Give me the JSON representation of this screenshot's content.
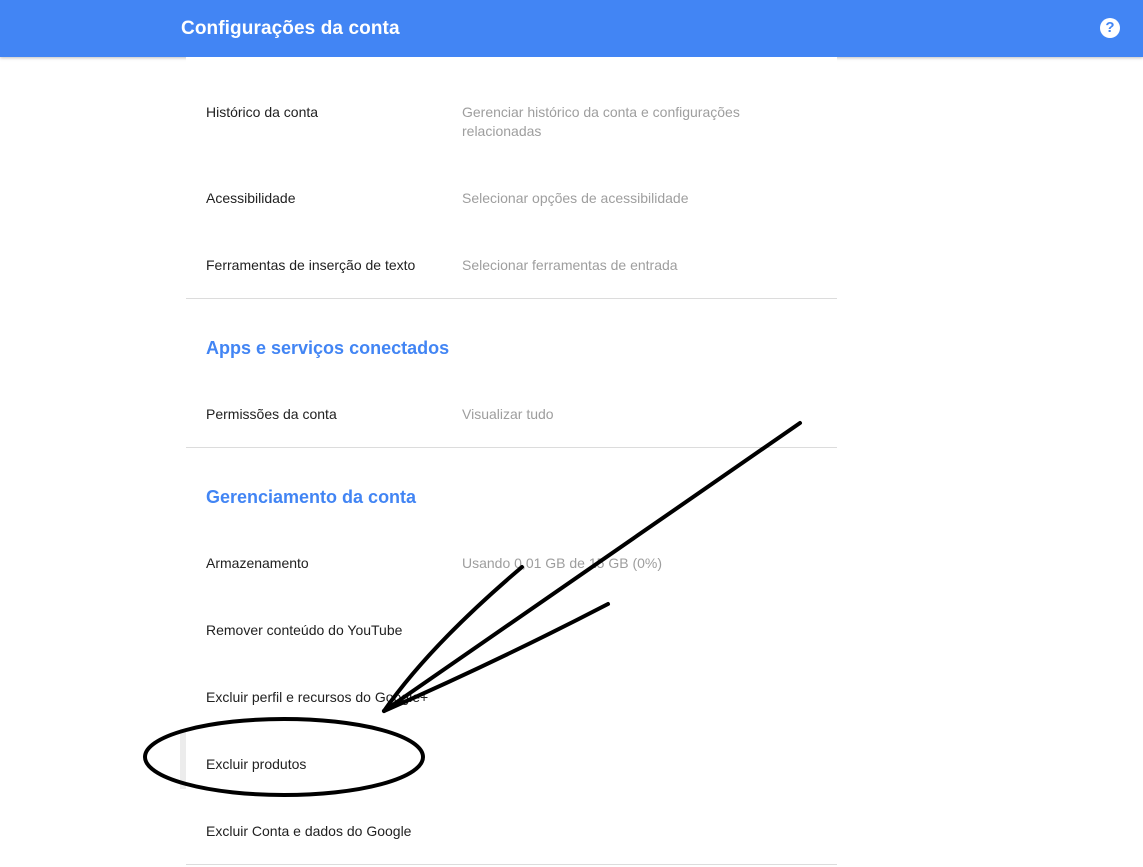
{
  "header": {
    "title": "Configurações da conta",
    "help_icon": "?"
  },
  "preferences": {
    "items": [
      {
        "label": "Histórico da conta",
        "desc": "Gerenciar histórico da conta e configurações relacionadas"
      },
      {
        "label": "Acessibilidade",
        "desc": "Selecionar opções de acessibilidade"
      },
      {
        "label": "Ferramentas de inserção de texto",
        "desc": "Selecionar ferramentas de entrada"
      }
    ]
  },
  "connected": {
    "title": "Apps e serviços conectados",
    "items": [
      {
        "label": "Permissões da conta",
        "desc": "Visualizar tudo"
      }
    ]
  },
  "management": {
    "title": "Gerenciamento da conta",
    "items": [
      {
        "label": "Armazenamento",
        "desc": "Usando 0,01 GB de 15 GB (0%)"
      },
      {
        "label": "Remover conteúdo do YouTube"
      },
      {
        "label": "Excluir perfil e recursos do Google+"
      },
      {
        "label": "Excluir produtos"
      },
      {
        "label": "Excluir Conta e dados do Google"
      }
    ]
  },
  "colors": {
    "accent": "#4285f4",
    "text": "#212121",
    "muted": "#9e9e9e",
    "annotation": "#000000"
  }
}
